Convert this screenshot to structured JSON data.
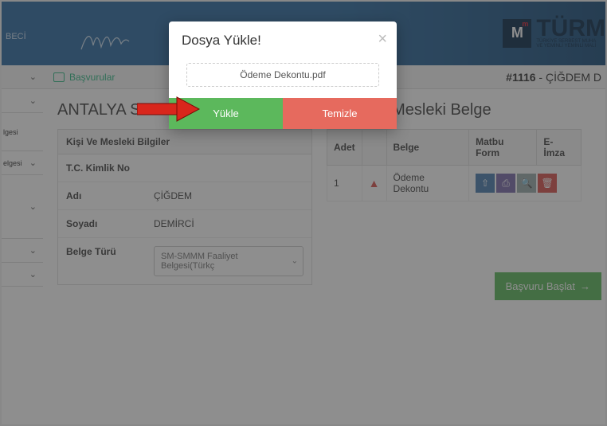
{
  "header": {
    "beci": "BECİ",
    "brand_letter": "M",
    "brand_small": "m",
    "brand_big": "TÜRM",
    "brand_sub1": "TÜRKİYE SERBEST MUHA",
    "brand_sub2": "VE YEMİNLİ YEMİNLİ MALİ"
  },
  "topbar": {
    "basvurular": "Başvurular",
    "crumb_id": "#1116",
    "crumb_sep": " - ",
    "crumb_name": "ÇİĞDEM D"
  },
  "sidebar": {
    "labels": [
      "",
      "",
      "lgesi",
      "elgesi",
      "",
      "",
      ""
    ]
  },
  "page": {
    "title_left": "ANTALYA SERBES",
    "title_right": "ASI Mesleki Belge"
  },
  "panel": {
    "heading": "Kişi Ve Mesleki Bilgiler",
    "rows": [
      {
        "label": "T.C. Kimlik No",
        "value": ""
      },
      {
        "label": "Adı",
        "value": "ÇİĞDEM"
      },
      {
        "label": "Soyadı",
        "value": "DEMİRCİ"
      },
      {
        "label": "Belge Türü",
        "value": ""
      }
    ],
    "select_text": "SM-SMMM Faaliyet Belgesi(Türkç"
  },
  "table": {
    "headers": [
      "Adet",
      "",
      "Belge",
      "Matbu Form",
      "E-İmza"
    ],
    "row": {
      "adet": "1",
      "belge": "Ödeme Dekontu"
    }
  },
  "start_button": "Başvuru Başlat",
  "modal": {
    "title": "Dosya Yükle!",
    "filename": "Ödeme Dekontu.pdf",
    "upload": "Yükle",
    "clear": "Temizle"
  }
}
